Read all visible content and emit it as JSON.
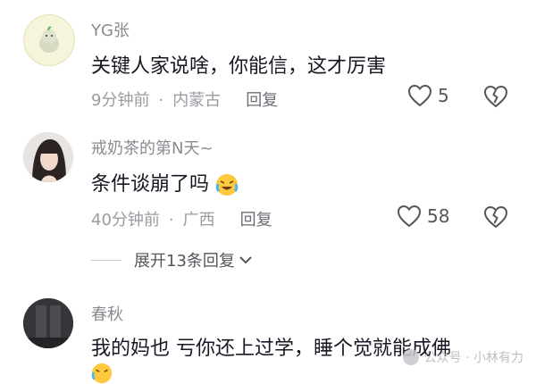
{
  "comments": [
    {
      "username": "YG张",
      "content": "关键人家说啥，你能信，这才厉害",
      "time": "9分钟前",
      "location": "内蒙古",
      "reply_label": "回复",
      "likes": "5"
    },
    {
      "username": "戒奶茶的第N天~",
      "content": "条件谈崩了吗",
      "time": "40分钟前",
      "location": "广西",
      "reply_label": "回复",
      "likes": "58"
    },
    {
      "username": "春秋",
      "content": "我的妈也 亏你还上过学，睡个觉就能成佛"
    }
  ],
  "expand_replies": "展开13条回复",
  "separator": "·",
  "watermark": "公众号 · 小林有力",
  "colors": {
    "meta": "#9a9ba1",
    "username": "#8a8b91",
    "text": "#161823"
  }
}
